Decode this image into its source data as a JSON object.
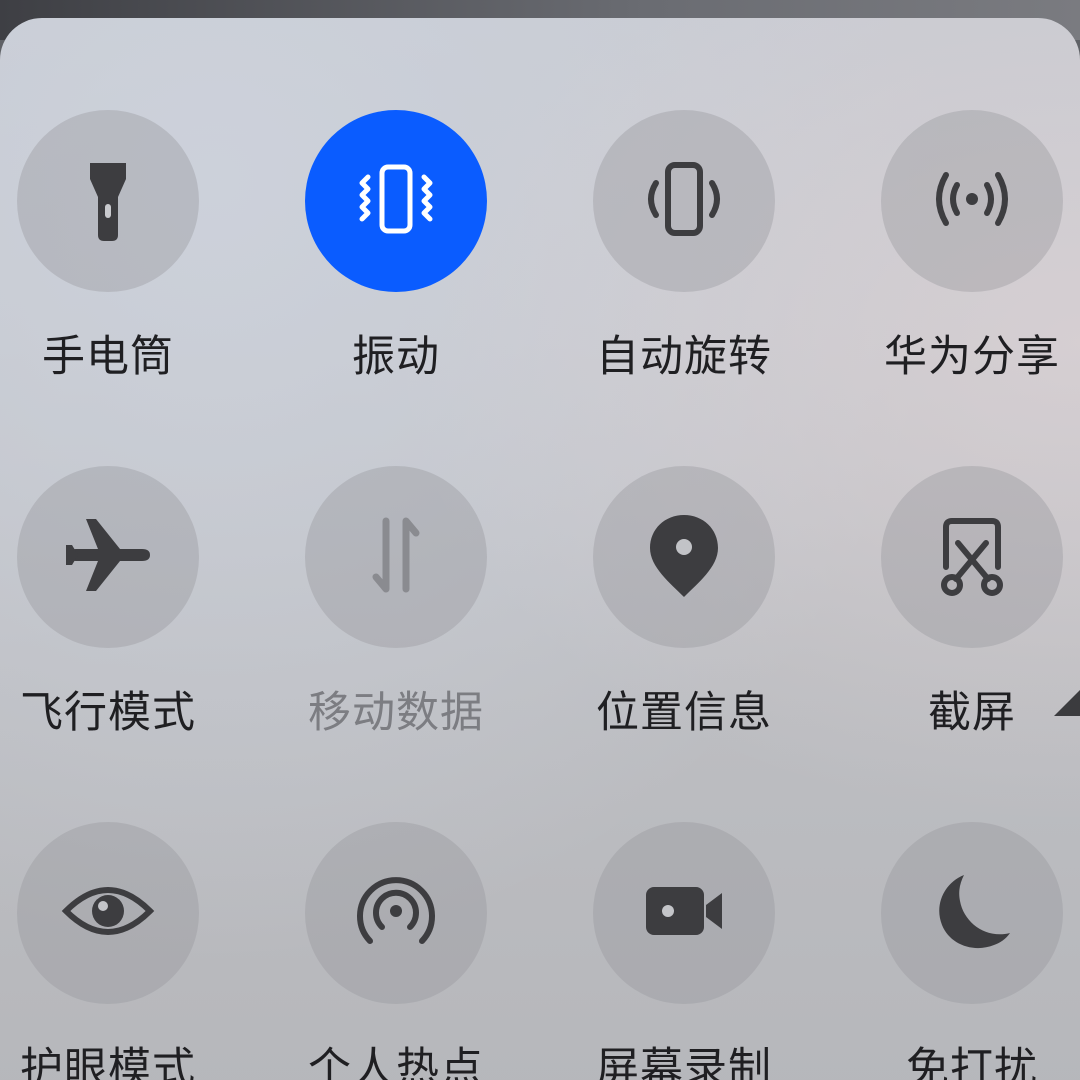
{
  "colors": {
    "accent": "#0a5cff",
    "icon_default": "#3d3d40",
    "icon_disabled": "#8a8b90",
    "label": "#1f1f22",
    "label_disabled": "#7c7d82"
  },
  "tiles": [
    {
      "label": "手电筒",
      "icon": "flashlight-icon",
      "active": false,
      "disabled": false
    },
    {
      "label": "振动",
      "icon": "vibrate-icon",
      "active": true,
      "disabled": false
    },
    {
      "label": "自动旋转",
      "icon": "auto-rotate-icon",
      "active": false,
      "disabled": false
    },
    {
      "label": "华为分享",
      "icon": "huawei-share-icon",
      "active": false,
      "disabled": false
    },
    {
      "label": "飞行模式",
      "icon": "airplane-icon",
      "active": false,
      "disabled": false
    },
    {
      "label": "移动数据",
      "icon": "mobile-data-icon",
      "active": false,
      "disabled": true
    },
    {
      "label": "位置信息",
      "icon": "location-pin-icon",
      "active": false,
      "disabled": false
    },
    {
      "label": "截屏",
      "icon": "screenshot-scissors-icon",
      "active": false,
      "disabled": false
    },
    {
      "label": "护眼模式",
      "icon": "eye-icon",
      "active": false,
      "disabled": false
    },
    {
      "label": "个人热点",
      "icon": "hotspot-icon",
      "active": false,
      "disabled": false
    },
    {
      "label": "屏幕录制",
      "icon": "video-camera-icon",
      "active": false,
      "disabled": false
    },
    {
      "label": "免打扰",
      "icon": "moon-icon",
      "active": false,
      "disabled": false
    }
  ],
  "edit_handle": {
    "icon": "corner-triangle-icon"
  }
}
